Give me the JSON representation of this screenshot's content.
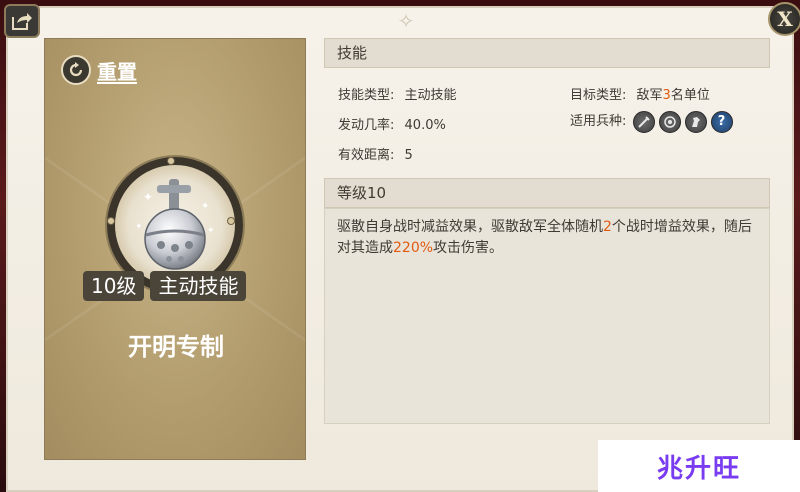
{
  "header": {
    "share_icon": "share-icon",
    "close_label": "X"
  },
  "card": {
    "reset_label": "重置",
    "level_tag": "10级",
    "type_tag": "主动技能",
    "specialty": "开明专制"
  },
  "info": {
    "title": "技能",
    "skill_type_label": "技能类型:",
    "skill_type_value": "主动技能",
    "target_type_label": "目标类型:",
    "target_prefix": "敌军",
    "target_count": "3",
    "target_suffix": "名单位",
    "chance_label": "发动几率:",
    "chance_value": "40.0%",
    "troops_label": "适用兵种:",
    "troops": [
      "sword-icon",
      "bow-icon",
      "horse-icon",
      "question-icon"
    ],
    "range_label": "有效距离:",
    "range_value": "5"
  },
  "level": {
    "title": "等级10",
    "desc_part1": "驱散自身战时减益效果，驱散敌军全体随机",
    "desc_num1": "2",
    "desc_part2": "个战时增益效果，随后对其造成",
    "desc_num2": "220%",
    "desc_part3": "攻击伤害。"
  },
  "colors": {
    "highlight": "#e05a10",
    "card_bg": "#b19b6c",
    "frame_bg": "#f6f2ea"
  },
  "watermark": {
    "text": "兆升旺"
  }
}
